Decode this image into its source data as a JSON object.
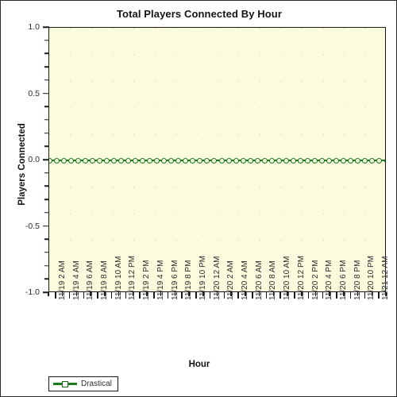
{
  "chart_data": {
    "type": "line",
    "title": "Total Players Connected By Hour",
    "xlabel": "Hour",
    "ylabel": "Players Connected",
    "ylim": [
      -1.0,
      1.0
    ],
    "y_ticks": [
      "1.0",
      "0.5",
      "0.0",
      "-0.5",
      "-1.0"
    ],
    "y_tick_values": [
      1.0,
      0.5,
      0.0,
      -0.5,
      -1.0
    ],
    "y_minor_tick_count": 4,
    "grid": true,
    "grid_style": "dotted",
    "legend_position": "bottom-left",
    "categories": [
      "11/19 2 AM",
      "11/19 4 AM",
      "11/19 6 AM",
      "11/19 8 AM",
      "11/19 10 AM",
      "11/19 12 PM",
      "11/19 2 PM",
      "11/19 4 PM",
      "11/19 6 PM",
      "11/19 8 PM",
      "11/19 10 PM",
      "11/20 12 AM",
      "11/20 2 AM",
      "11/20 4 AM",
      "11/20 6 AM",
      "11/20 8 AM",
      "11/20 10 AM",
      "11/20 12 PM",
      "11/20 2 PM",
      "11/20 4 PM",
      "11/20 6 PM",
      "11/20 8 PM",
      "11/20 10 PM",
      "11/21 12 AM"
    ],
    "series": [
      {
        "name": "Drastical",
        "color": "#1c7a1c",
        "marker": "circle",
        "values": [
          0,
          0,
          0,
          0,
          0,
          0,
          0,
          0,
          0,
          0,
          0,
          0,
          0,
          0,
          0,
          0,
          0,
          0,
          0,
          0,
          0,
          0,
          0,
          0,
          0,
          0,
          0,
          0,
          0,
          0,
          0,
          0,
          0,
          0,
          0,
          0,
          0,
          0,
          0,
          0,
          0,
          0,
          0,
          0,
          0,
          0,
          0,
          0
        ]
      }
    ]
  },
  "colors": {
    "plot_background": "#fbfbdd",
    "page_background": "#ffffff",
    "axis": "#1a1a1a",
    "series_green": "#1c7a1c",
    "grid_dot": "#d8cfc4",
    "text": "#2b2b2b"
  },
  "legend": {
    "items": [
      {
        "label": "Drastical"
      }
    ]
  }
}
